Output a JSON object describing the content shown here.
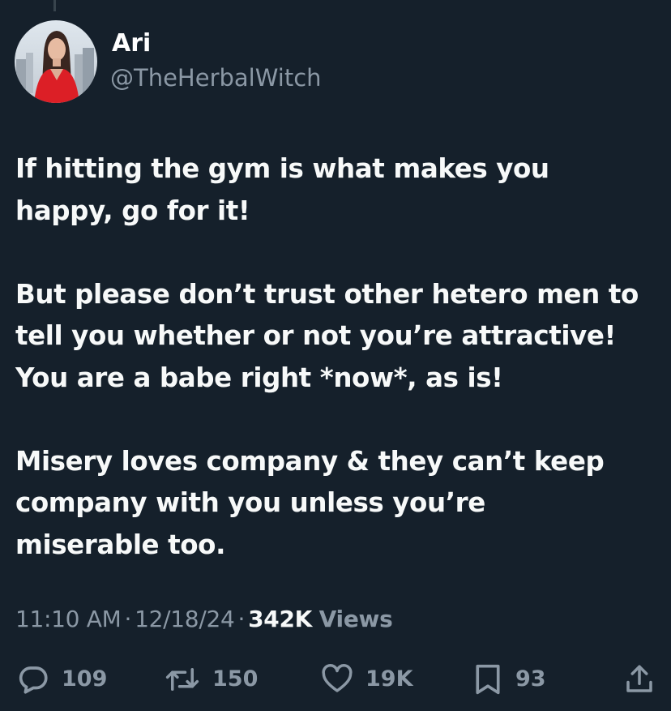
{
  "author": {
    "display_name": "Ari",
    "handle": "@TheHerbalWitch"
  },
  "tweet": {
    "paragraphs": [
      "If hitting the gym is what makes you\nhappy, go for it!",
      "But please don’t trust other hetero men to\ntell you whether or not you’re attractive!\nYou are a babe right *now*, as is!",
      "Misery loves company & they can’t keep\ncompany with you unless you’re\nmiserable too."
    ]
  },
  "meta": {
    "time": "11:10 AM",
    "date": "12/18/24",
    "separator": "·",
    "views_count": "342K",
    "views_label": "Views"
  },
  "actions": {
    "reply": {
      "icon": "reply-icon",
      "count": "109"
    },
    "retweet": {
      "icon": "retweet-icon",
      "count": "150"
    },
    "like": {
      "icon": "heart-icon",
      "count": "19K"
    },
    "bookmark": {
      "icon": "bookmark-icon",
      "count": "93"
    },
    "share": {
      "icon": "share-icon"
    }
  },
  "colors": {
    "background": "#15202b",
    "primary_text": "#f7f9f9",
    "secondary_text": "#8b98a5",
    "icon": "#8b98a5"
  }
}
